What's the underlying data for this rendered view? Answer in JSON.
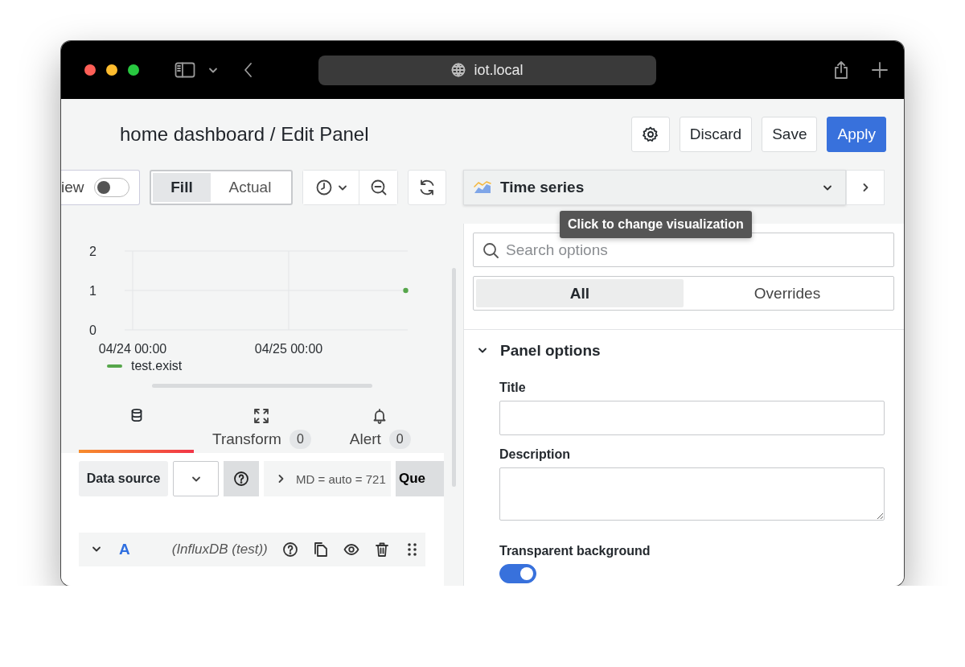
{
  "browser": {
    "url": "iot.local"
  },
  "header": {
    "title": "home dashboard / Edit Panel",
    "buttons": [
      {
        "kind": "settings"
      },
      {
        "kind": "secondary",
        "label": "Discard"
      },
      {
        "kind": "secondary",
        "label": "Save"
      },
      {
        "kind": "primary",
        "label": "Apply"
      }
    ]
  },
  "toolbar": {
    "view_toggle": {
      "label": "iew",
      "on": false
    },
    "size_modes": [
      {
        "label": "Fill",
        "selected": true
      },
      {
        "label": "Actual",
        "selected": false
      }
    ]
  },
  "chart": {
    "chart_data": {
      "type": "line",
      "grid": true,
      "categories": [
        "04/24 00:00",
        null,
        null,
        null,
        "04/25 00:00",
        null,
        null,
        null
      ],
      "ylim": [
        0,
        2
      ],
      "yticks": [
        0,
        1,
        2
      ],
      "series": [
        {
          "name": "test.exist",
          "color": "#56a64b",
          "marker": "circle",
          "values": [
            null,
            null,
            null,
            null,
            null,
            null,
            null,
            1
          ]
        }
      ]
    }
  },
  "query_tabs": [
    {
      "kind": "queries",
      "selected": true
    },
    {
      "kind": "transform",
      "label": "Transform",
      "count": "0",
      "selected": false
    },
    {
      "kind": "alert",
      "label": "Alert",
      "count": "0",
      "selected": false
    }
  ],
  "data_source_row": {
    "label": "Data source",
    "options_summary": "MD = auto = 721",
    "query_button": "Que"
  },
  "queries": [
    {
      "ref": "A",
      "source": "(InfluxDB (test))",
      "expanded": true
    }
  ],
  "visualization": {
    "name": "Time series",
    "tooltip": "Click to change visualization"
  },
  "options": {
    "search_placeholder": "Search options",
    "tabs": [
      {
        "label": "All",
        "selected": true
      },
      {
        "label": "Overrides",
        "selected": false
      }
    ],
    "sections": [
      {
        "title": "Panel options",
        "expanded": true,
        "fields": [
          {
            "kind": "text",
            "label": "Title"
          },
          {
            "kind": "textarea",
            "label": "Description"
          },
          {
            "kind": "switch",
            "label": "Transparent background",
            "on": true
          }
        ]
      }
    ]
  }
}
